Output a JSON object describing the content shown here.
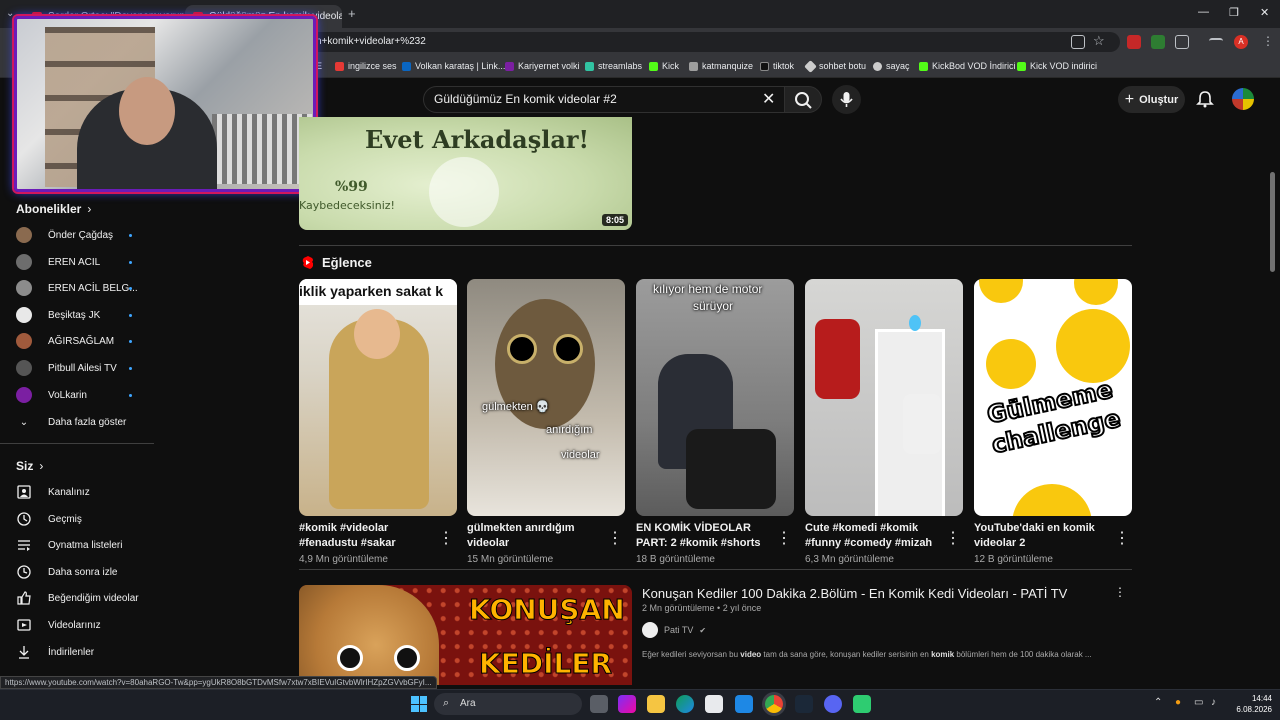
{
  "browser": {
    "tabs": [
      {
        "title": "Serdar Ortaç: \"Dayanamıyorum\"",
        "active": false
      },
      {
        "title": "Güldüğümüz En komik videolar",
        "active": true
      }
    ],
    "new_tab": "+",
    "url": "n+komik+videolar+%232",
    "window_controls": {
      "minimize": "—",
      "maximize": "❐",
      "close": "✕"
    },
    "bookmarks": [
      {
        "label": "E"
      },
      {
        "label": "ingilizce ses",
        "color": "#e53935"
      },
      {
        "label": "Volkan karataş | Link...",
        "color": "#0a66c2"
      },
      {
        "label": "Kariyernet volki",
        "color": "#7b1fa2"
      },
      {
        "label": "streamlabs",
        "color": "#31c3a2"
      },
      {
        "label": "Kick",
        "color": "#53fc18"
      },
      {
        "label": "katmanquize",
        "color": "#9e9e9e"
      },
      {
        "label": "tiktok",
        "color": "#111111"
      },
      {
        "label": "sohbet botu",
        "color": "#cccccc"
      },
      {
        "label": "sayaç",
        "color": "#cccccc"
      },
      {
        "label": "KickBod VOD İndirici",
        "color": "#53fc18"
      },
      {
        "label": "Kick VOD indirici",
        "color": "#53fc18"
      }
    ],
    "profile_initial": "A"
  },
  "youtube": {
    "search_query": "Güldüğümüz En komik videolar #2",
    "create_label": "Oluştur",
    "sidebar": {
      "subs_heading": "Abonelikler",
      "subscriptions": [
        {
          "name": "Önder Çağdaş",
          "color": "#8a6a4f"
        },
        {
          "name": "EREN ACIL",
          "color": "#6d6d6d"
        },
        {
          "name": "EREN ACİL BELG...",
          "color": "#8c8c8c"
        },
        {
          "name": "Beşiktaş JK",
          "color": "#e8e8e8"
        },
        {
          "name": "AĞIRSAĞLAM",
          "color": "#a05a3c"
        },
        {
          "name": "Pitbull Ailesi TV",
          "color": "#555555"
        },
        {
          "name": "VoLkarin",
          "color": "#7b1fa2"
        }
      ],
      "show_more": "Daha fazla göster",
      "you_heading": "Siz",
      "you_items": [
        {
          "label": "Kanalınız",
          "icon": "channel-icon"
        },
        {
          "label": "Geçmiş",
          "icon": "history-icon"
        },
        {
          "label": "Oynatma listeleri",
          "icon": "playlists-icon"
        },
        {
          "label": "Daha sonra izle",
          "icon": "watch-later-icon"
        },
        {
          "label": "Beğendiğim videolar",
          "icon": "liked-icon"
        },
        {
          "label": "Videolarınız",
          "icon": "your-videos-icon"
        },
        {
          "label": "İndirilenler",
          "icon": "downloads-icon"
        }
      ]
    },
    "top_video": {
      "thumb_text": "Evet Arkadaşlar!",
      "thumb_sub": "%99",
      "thumb_sub2": "Kaybedeceksiniz!",
      "duration": "8:05"
    },
    "shelf_title": "Eğlence",
    "shorts": [
      {
        "overlay": "iklik yaparken sakat k",
        "title": "#komik #videolar #fenadustu #sakar",
        "views": "4,9 Mn görüntüleme"
      },
      {
        "overlay": "gülmekten 💀",
        "overlay2": "anırdığım",
        "overlay3": "videolar",
        "title": "gülmekten anırdığım videolar",
        "views": "15 Mn görüntüleme"
      },
      {
        "overlay": "kılıyor hem de motor",
        "overlay2": "sürüyor",
        "title": "EN KOMİK VİDEOLAR PART: 2 #komik #shorts",
        "views": "18 B görüntüleme"
      },
      {
        "title": "Cute  #komedi #komik #funny #comedy #mizah",
        "views": "6,3 Mn görüntüleme"
      },
      {
        "overlay": "Gülmeme",
        "overlay2": "challenge",
        "title": "YouTube'daki en komik videolar 2",
        "views": "12 B görüntüleme"
      }
    ],
    "long_video": {
      "title": "Konuşan Kediler 100 Dakika 2.Bölüm - En Komik Kedi Videoları - PATİ TV",
      "meta": "2 Mn görüntüleme • 2 yıl önce",
      "channel": "Pati TV",
      "description_pre": "Eğer kedileri seviyorsan bu ",
      "description_b1": "video",
      "description_mid": " tam da sana göre, konuşan kediler serisinin en ",
      "description_b2": "komik",
      "description_post": " bölümleri hem de 100 dakika olarak ...",
      "thumb_text": "KONUŞAN",
      "thumb_text2": "KEDİLER"
    },
    "status_url": "https://www.youtube.com/watch?v=80ahaRGO-Tw&pp=ygUkR8O8bGTDvMSfw7xtw7xBIEVuIGtvbWlrIHZpZGVvbGFyI..."
  },
  "taskbar": {
    "search_label": "Ara",
    "time": "14:44",
    "date": "6.08.2026"
  },
  "colors": {
    "accent": "#3ea6ff",
    "youtube_red": "#ff0000"
  }
}
